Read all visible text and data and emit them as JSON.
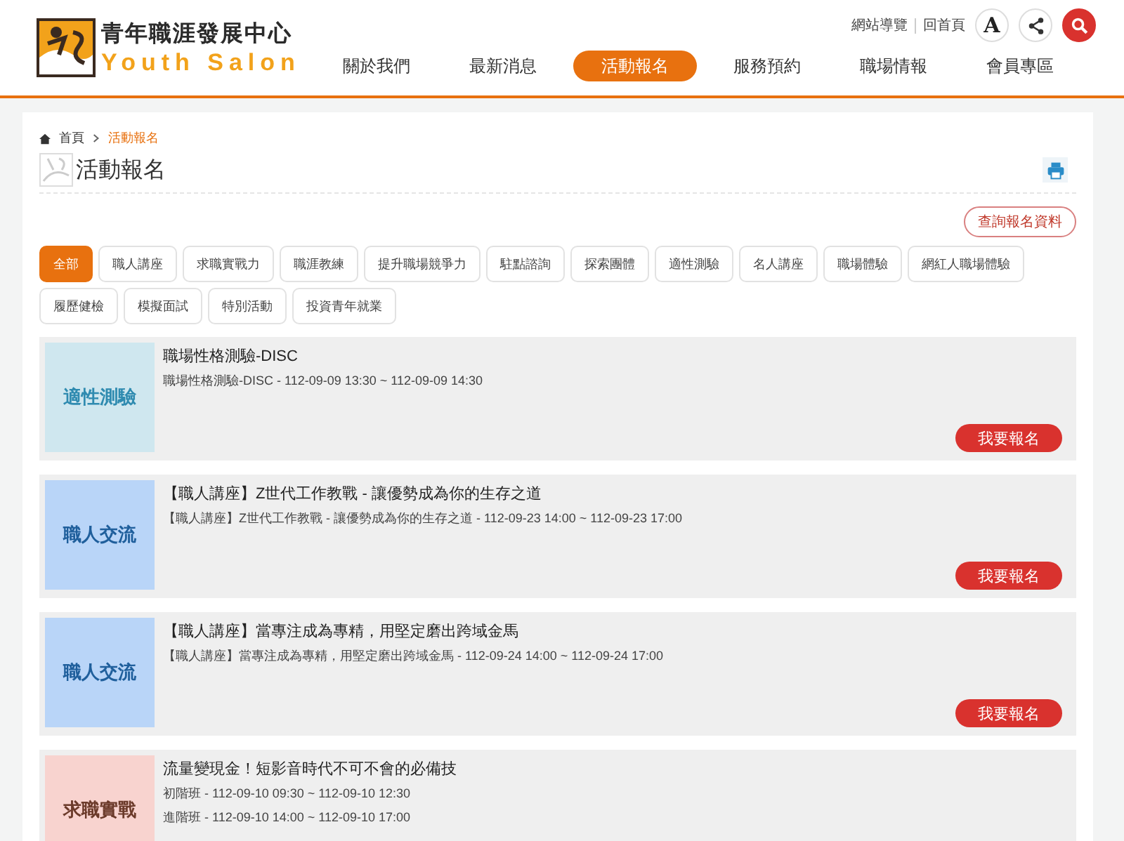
{
  "header": {
    "logo_title": "青年職涯發展中心",
    "logo_subtitle": "Youth Salon",
    "utility_links": [
      "網站導覽",
      "回首頁"
    ],
    "font_size_button": "A",
    "nav": [
      {
        "label": "關於我們",
        "selected": false
      },
      {
        "label": "最新消息",
        "selected": false
      },
      {
        "label": "活動報名",
        "selected": true
      },
      {
        "label": "服務預約",
        "selected": false
      },
      {
        "label": "職場情報",
        "selected": false
      },
      {
        "label": "會員專區",
        "selected": false
      }
    ]
  },
  "breadcrumb": [
    "首頁",
    "活動報名"
  ],
  "page_title": "活動報名",
  "query_button": "查詢報名資料",
  "filters": [
    {
      "label": "全部",
      "selected": true
    },
    {
      "label": "職人講座",
      "selected": false
    },
    {
      "label": "求職實戰力",
      "selected": false
    },
    {
      "label": "職涯教練",
      "selected": false
    },
    {
      "label": "提升職場競爭力",
      "selected": false
    },
    {
      "label": "駐點諮詢",
      "selected": false
    },
    {
      "label": "探索團體",
      "selected": false
    },
    {
      "label": "適性測驗",
      "selected": false
    },
    {
      "label": "名人講座",
      "selected": false
    },
    {
      "label": "職場體驗",
      "selected": false
    },
    {
      "label": "網紅人職場體驗",
      "selected": false
    },
    {
      "label": "履歷健檢",
      "selected": false
    },
    {
      "label": "模擬面試",
      "selected": false
    },
    {
      "label": "特別活動",
      "selected": false
    },
    {
      "label": "投資青年就業",
      "selected": false
    }
  ],
  "events": [
    {
      "thumb": {
        "kind": "test",
        "label": "適性測驗"
      },
      "title": "職場性格測驗-DISC",
      "sessions": [
        "職場性格測驗-DISC - 112-09-09 13:30 ~ 112-09-09 14:30"
      ],
      "button": "我要報名"
    },
    {
      "thumb": {
        "kind": "talk",
        "label": "職人交流"
      },
      "title": "【職人講座】Z世代工作教戰 - 讓優勢成為你的生存之道",
      "sessions": [
        "【職人講座】Z世代工作教戰 - 讓優勢成為你的生存之道 - 112-09-23 14:00 ~ 112-09-23 17:00"
      ],
      "button": "我要報名"
    },
    {
      "thumb": {
        "kind": "talk",
        "label": "職人交流"
      },
      "title": "【職人講座】當專注成為專精，用堅定磨出跨域金馬",
      "sessions": [
        "【職人講座】當專注成為專精，用堅定磨出跨域金馬 - 112-09-24 14:00 ~ 112-09-24 17:00"
      ],
      "button": "我要報名"
    },
    {
      "thumb": {
        "kind": "job",
        "label": "求職實戰"
      },
      "title": "流量變現金！短影音時代不可不會的必備技",
      "sessions": [
        "初階班 - 112-09-10 09:30 ~ 112-09-10 12:30",
        "進階班 - 112-09-10 14:00 ~ 112-09-10 17:00"
      ]
    }
  ]
}
